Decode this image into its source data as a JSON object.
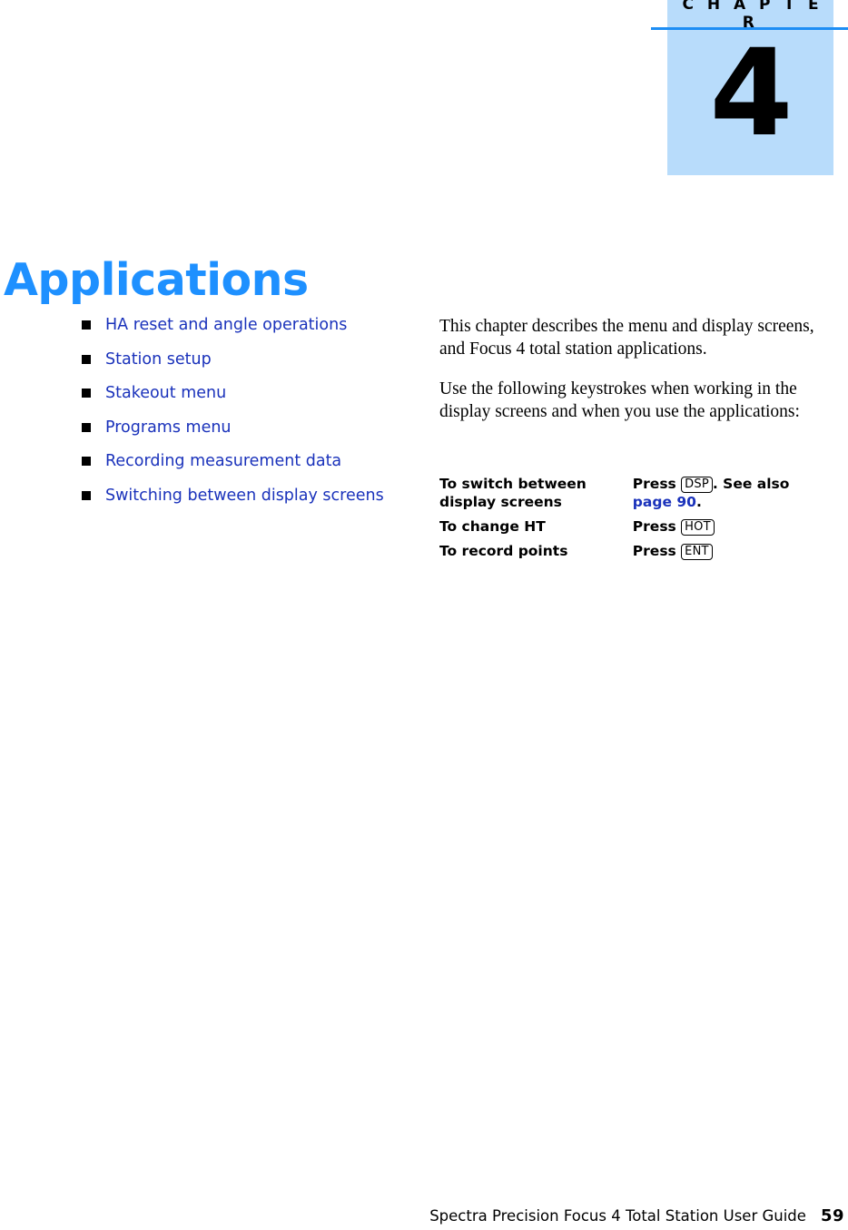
{
  "chapter": {
    "label": "C H A P T E R",
    "number": "4",
    "block_color": "#b8dcfb",
    "rule_color": "#1e8ef4"
  },
  "page_title": "Applications",
  "title_color": "#1e90ff",
  "link_color": "#1a32bb",
  "toc": {
    "items": [
      {
        "label": "HA reset and angle operations"
      },
      {
        "label": "Station setup"
      },
      {
        "label": "Stakeout menu"
      },
      {
        "label": "Programs menu"
      },
      {
        "label": "Recording measurement data"
      },
      {
        "label": "Switching between display screens"
      }
    ]
  },
  "intro": {
    "paragraph_1": "This chapter describes the menu and display screens, and Focus 4 total station applications.",
    "paragraph_2": "Use the following keystrokes when working in the display screens and when you use the applications:"
  },
  "keystroke_table": {
    "rows": [
      {
        "action": "To switch between display screens",
        "press_label": "Press",
        "key": "DSP",
        "suffix_before_link": ". See also ",
        "link": "page 90",
        "suffix_after_link": "."
      },
      {
        "action": "To change HT",
        "press_label": "Press",
        "key": "HOT",
        "suffix_before_link": "",
        "link": "",
        "suffix_after_link": ""
      },
      {
        "action": "To record points",
        "press_label": "Press",
        "key": "ENT",
        "suffix_before_link": "",
        "link": "",
        "suffix_after_link": ""
      }
    ]
  },
  "footer": {
    "title": "Spectra Precision Focus 4 Total Station User Guide",
    "page_number": "59"
  }
}
